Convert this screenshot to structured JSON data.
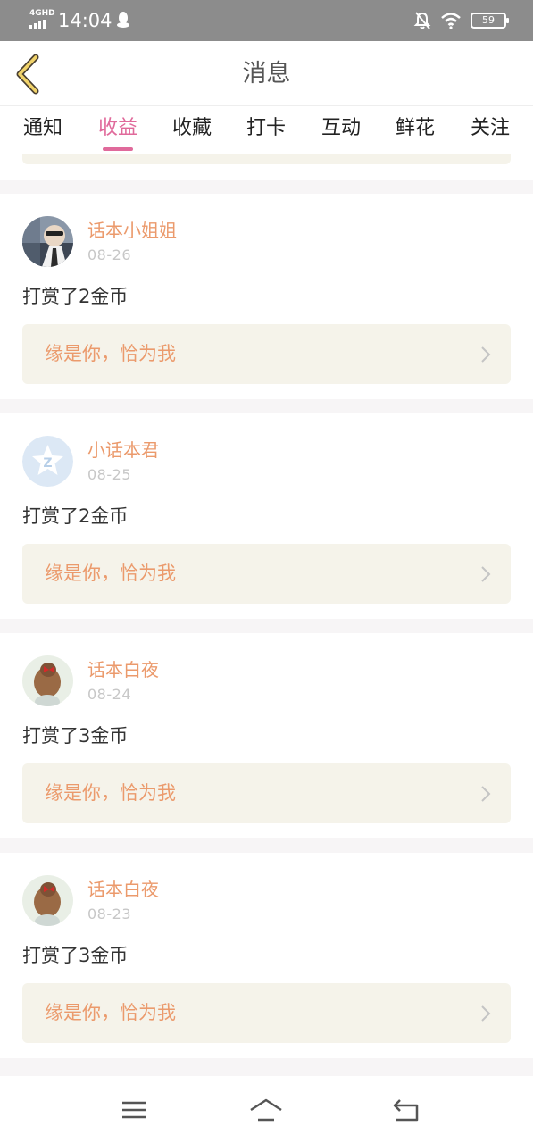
{
  "status_bar": {
    "network": "4GHD",
    "time": "14:04",
    "battery": "59",
    "icons": [
      "signal-icon",
      "qq-penguin-icon",
      "mute-bell-icon",
      "wifi-icon",
      "battery-icon"
    ]
  },
  "nav": {
    "title": "消息",
    "back_icon": "chevron-left-icon"
  },
  "tabs": [
    {
      "label": "通知",
      "active": false
    },
    {
      "label": "收益",
      "active": true
    },
    {
      "label": "收藏",
      "active": false
    },
    {
      "label": "打卡",
      "active": false
    },
    {
      "label": "互动",
      "active": false
    },
    {
      "label": "鲜花",
      "active": false
    },
    {
      "label": "关注",
      "active": false
    }
  ],
  "messages": [
    {
      "username": "话本小姐姐",
      "date": "08-26",
      "action": "打赏了2金币",
      "work_title": "缘是你，恰为我",
      "avatar": "avatar-photo"
    },
    {
      "username": "小话本君",
      "date": "08-25",
      "action": "打赏了2金币",
      "work_title": "缘是你，恰为我",
      "avatar": "avatar-default"
    },
    {
      "username": "话本白夜",
      "date": "08-24",
      "action": "打赏了3金币",
      "work_title": "缘是你，恰为我",
      "avatar": "avatar-photo"
    },
    {
      "username": "话本白夜",
      "date": "08-23",
      "action": "打赏了3金币",
      "work_title": "缘是你，恰为我",
      "avatar": "avatar-photo"
    }
  ],
  "system_nav": {
    "icons": [
      "menu-icon",
      "home-icon",
      "back-icon"
    ]
  },
  "colors": {
    "accent_pink": "#e06a9b",
    "username_orange": "#eb9a6c",
    "link_bg": "#f5f3ea",
    "status_bar": "#8c8c8c"
  }
}
